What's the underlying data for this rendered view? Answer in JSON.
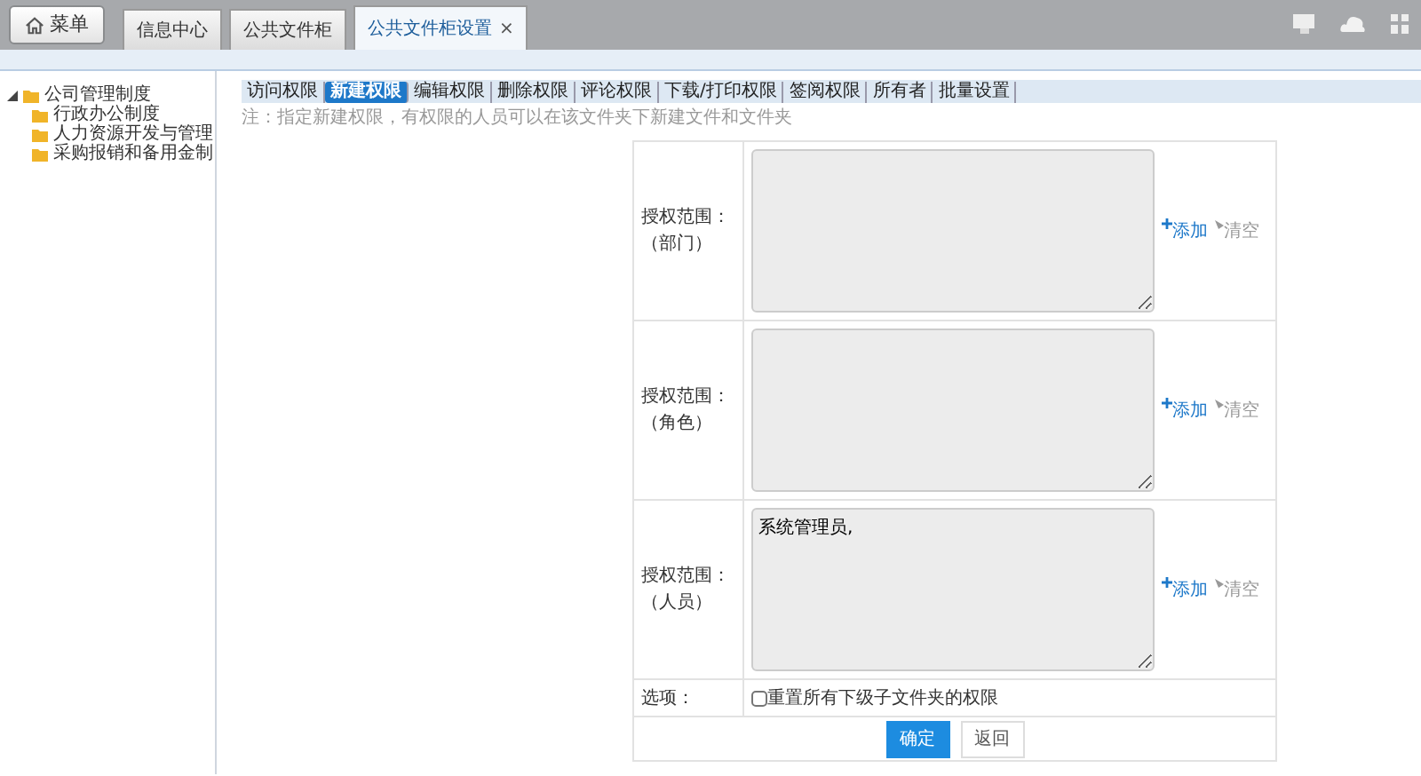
{
  "menu_button": {
    "label": "菜单"
  },
  "tabs": [
    {
      "label": "信息中心",
      "selected": false,
      "closable": false
    },
    {
      "label": "公共文件柜",
      "selected": false,
      "closable": false
    },
    {
      "label": "公共文件柜设置",
      "selected": true,
      "closable": true
    }
  ],
  "close_glyph": "×",
  "tree": [
    {
      "label": "公司管理制度",
      "expanded": true,
      "children": [
        {
          "label": "行政办公制度"
        },
        {
          "label": "人力资源开发与管理"
        },
        {
          "label": "采购报销和备用金制"
        }
      ]
    }
  ],
  "permission_tabs": [
    {
      "label": "访问权限",
      "selected": false
    },
    {
      "label": "新建权限",
      "selected": true
    },
    {
      "label": "编辑权限",
      "selected": false
    },
    {
      "label": "删除权限",
      "selected": false
    },
    {
      "label": "评论权限",
      "selected": false
    },
    {
      "label": "下载/打印权限",
      "selected": false
    },
    {
      "label": "签阅权限",
      "selected": false
    },
    {
      "label": "所有者",
      "selected": false
    },
    {
      "label": "批量设置",
      "selected": false
    }
  ],
  "note": "注：指定新建权限，有权限的人员可以在该文件夹下新建文件和文件夹",
  "scopes": [
    {
      "label": "授权范围：",
      "sublabel": "（部门）",
      "add": "添加",
      "clear": "清空"
    },
    {
      "label": "授权范围：",
      "sublabel": "（角色）",
      "add": "添加",
      "clear": "清空"
    },
    {
      "label": "授权范围：",
      "sublabel": "（人员）",
      "value": "系统管理员,",
      "add": "添加",
      "clear": "清空"
    }
  ],
  "option": {
    "label": "选项：",
    "checkbox_label": "重置所有下级子文件夹的权限",
    "checked": false
  },
  "buttons": [
    {
      "label": "确定",
      "kind": "primary"
    },
    {
      "label": "返回",
      "kind": "secondary"
    }
  ]
}
